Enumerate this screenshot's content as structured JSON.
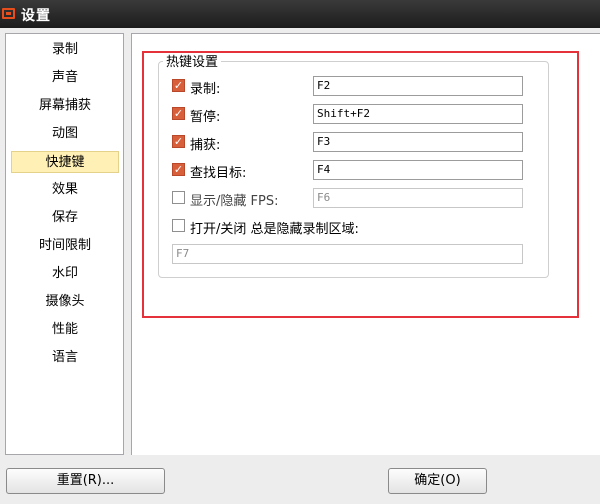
{
  "window": {
    "title": "设置"
  },
  "sidebar": {
    "items": [
      {
        "label": "录制"
      },
      {
        "label": "声音"
      },
      {
        "label": "屏幕捕获"
      },
      {
        "label": "动图"
      },
      {
        "label": "快捷键",
        "selected": true
      },
      {
        "label": "效果"
      },
      {
        "label": "保存"
      },
      {
        "label": "时间限制"
      },
      {
        "label": "水印"
      },
      {
        "label": "摄像头"
      },
      {
        "label": "性能"
      },
      {
        "label": "语言"
      }
    ]
  },
  "hotkeys": {
    "group_title": "热键设置",
    "rows": [
      {
        "label": "录制:",
        "checked": true,
        "value": "F2"
      },
      {
        "label": "暂停:",
        "checked": true,
        "value": "Shift+F2"
      },
      {
        "label": "捕获:",
        "checked": true,
        "value": "F3"
      },
      {
        "label": "查找目标:",
        "checked": true,
        "value": "F4"
      },
      {
        "label": "显示/隐藏 FPS:",
        "checked": false,
        "value": "F6"
      },
      {
        "label": "打开/关闭 总是隐藏录制区域:",
        "checked": false,
        "value": "F7"
      }
    ]
  },
  "buttons": {
    "reset_label": "重置(R)...",
    "ok_label": "确定(O)"
  },
  "colors": {
    "highlight_box": "#e5323a",
    "checkbox_checked": "#d7603a",
    "selected_item": "#fff0b6"
  }
}
